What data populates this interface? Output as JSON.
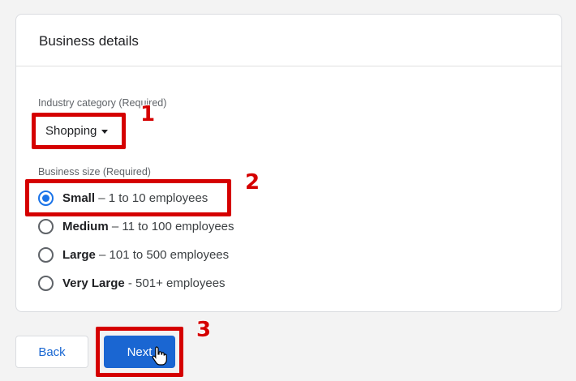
{
  "card": {
    "title": "Business details"
  },
  "industry": {
    "label": "Industry category (Required)",
    "selected": "Shopping"
  },
  "business_size": {
    "label": "Business size (Required)",
    "options": [
      {
        "name": "Small",
        "detail": " – 1 to 10 employees",
        "checked": true
      },
      {
        "name": "Medium",
        "detail": " – 11 to 100 employees",
        "checked": false
      },
      {
        "name": "Large",
        "detail": " – 101 to 500 employees",
        "checked": false
      },
      {
        "name": "Very Large",
        "detail": " - 501+ employees",
        "checked": false
      }
    ]
  },
  "buttons": {
    "back": "Back",
    "next": "Next"
  },
  "annotations": {
    "step1": "1",
    "step2": "2",
    "step3": "3"
  },
  "colors": {
    "accent": "#1a73e8",
    "highlight": "#d50000",
    "next_button": "#1a66d2"
  }
}
